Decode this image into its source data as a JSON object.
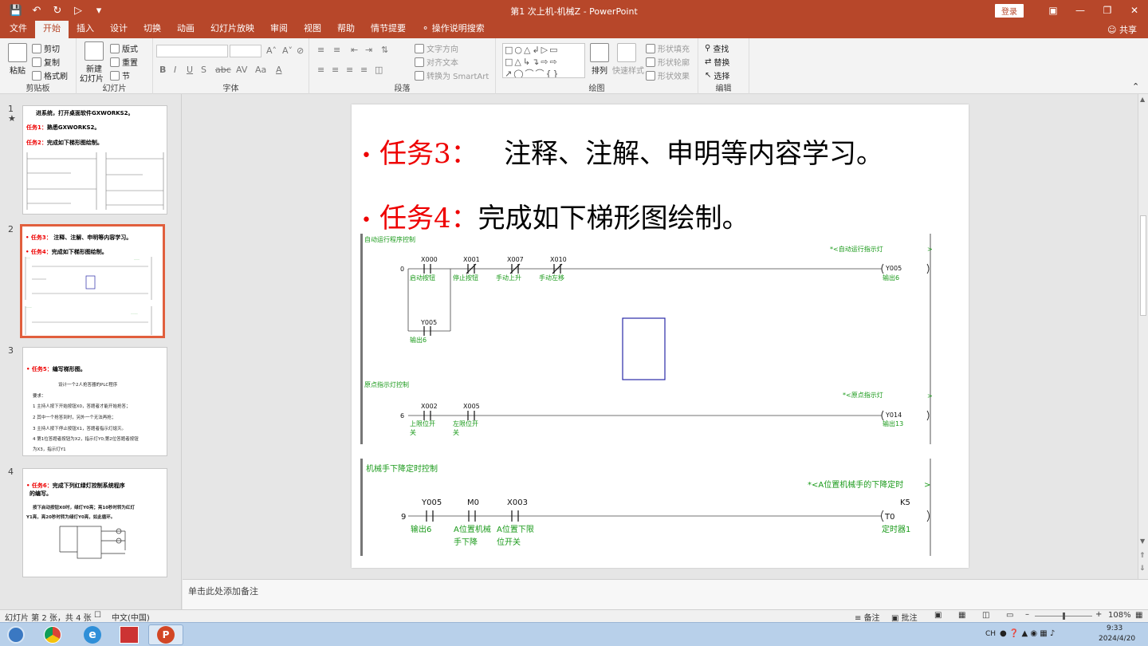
{
  "window": {
    "title": "第1 次上机-机械Z  -  PowerPoint",
    "login": "登录"
  },
  "menu": {
    "tabs": [
      "文件",
      "开始",
      "插入",
      "设计",
      "切换",
      "动画",
      "幻灯片放映",
      "审阅",
      "视图",
      "帮助",
      "情节提要"
    ],
    "search": "操作说明搜索",
    "share": "共享"
  },
  "ribbon": {
    "clipboard": {
      "paste": "粘贴",
      "cut": "剪切",
      "copy": "复制",
      "painter": "格式刷",
      "label": "剪贴板"
    },
    "slides": {
      "new_slide_1": "新建",
      "new_slide_2": "幻灯片",
      "layout": "版式",
      "reset": "重置",
      "section": "节",
      "label": "幻灯片"
    },
    "font": {
      "label": "字体"
    },
    "paragraph": {
      "text_direction": "文字方向",
      "align_text": "对齐文本",
      "smartart": "转换为 SmartArt",
      "label": "段落"
    },
    "drawing": {
      "arrange": "排列",
      "quick_styles": "快速样式",
      "shape_fill": "形状填充",
      "shape_outline": "形状轮廓",
      "shape_effects": "形状效果",
      "label": "绘图"
    },
    "editing": {
      "find": "查找",
      "replace": "替换",
      "select": "选择",
      "label": "编辑"
    }
  },
  "thumbnails": {
    "s1": {
      "num": "1",
      "l1": "进系统，打开桌面软件GXWORKS2。",
      "l2a": "任务1：",
      "l2b": "熟悉GXWORKS2。",
      "l3a": "任务2：",
      "l3b": "完成如下梯形图绘制。"
    },
    "s2": {
      "num": "2",
      "l1a": "任务3：",
      "l1b": "注释、注解、申明等内容学习。",
      "l2a": "任务4：",
      "l2b": "完成如下梯形图绘制。"
    },
    "s3": {
      "num": "3",
      "l1a": "任务5：",
      "l1b": "编写梯形图。",
      "title": "设计一个2人抢答器的PLC程序",
      "req": "要求：",
      "r1": "1 主持人按下开始按钮X0，答题者才能开始抢答；",
      "r2": "2 其中一个抢答到时，另外一个无法再抢；",
      "r3": "3 主持人按下停止按钮X1，答题者指示灯熄灭。",
      "r4": "4 第1位答题者按钮为X2，指示灯Y0;第2位答题者按钮",
      "r5": "为X3，指示灯Y1"
    },
    "s4": {
      "num": "4",
      "l1a": "任务6：",
      "l1b": "完成下列红绿灯控制系统程序",
      "l2": "的编写。",
      "d1": "按下启动按钮X0时，绿灯Y0亮；亮10秒时转为红灯",
      "d2": "Y1亮，亮20秒时转为绿灯Y0亮，如此循环。"
    }
  },
  "slide": {
    "b1_label": "任务3：",
    "b1_text": "注释、注解、申明等内容学习。",
    "b2_label": "任务4：",
    "b2_text": "完成如下梯形图绘制。",
    "ladder1": {
      "section1": "自动运行程序控制",
      "note1": "*<自动运行指示灯",
      "step0": "0",
      "c1": "X000",
      "c1l": "启动按钮",
      "c2": "X001",
      "c2l": "停止按钮",
      "c3": "X007",
      "c3l": "手动上升",
      "c4": "X010",
      "c4l": "手动左移",
      "coil1": "Y005",
      "coil1l": "输出6",
      "hold": "Y005",
      "holdl": "输出6",
      "section2": "原点指示灯控制",
      "note2": "*<原点指示灯",
      "step6": "6",
      "c5": "X002",
      "c5l1": "上限位开",
      "c5l2": "关",
      "c6": "X005",
      "c6l1": "左限位开",
      "c6l2": "关",
      "coil2": "Y014",
      "coil2l": "输出13",
      "arrow": ">"
    },
    "ladder2": {
      "section": "机械手下降定时控制",
      "note": "*<A位置机械手的下降定时",
      "step9": "9",
      "c1": "Y005",
      "c1l": "输出6",
      "c2": "M0",
      "c2l1": "A位置机械",
      "c2l2": "手下降",
      "c3": "X003",
      "c3l1": "A位置下限",
      "c3l2": "位开关",
      "k": "K5",
      "coil": "T0",
      "coill": "定时器1",
      "arrow": ">"
    }
  },
  "notes_placeholder": "单击此处添加备注",
  "status": {
    "slide_info": "幻灯片 第 2 张，共 4 张",
    "lang": "中文(中国)",
    "notes": "备注",
    "comments": "批注",
    "zoom": "108%"
  },
  "taskbar": {
    "ime": "CH",
    "time": "9:33",
    "date": "2024/4/20"
  }
}
